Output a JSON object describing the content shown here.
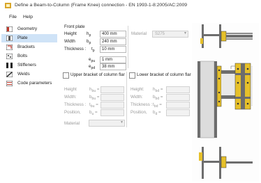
{
  "window": {
    "title": "Define a Beam-to-Column (Frame Knee) connection - EN 1993-1-8:2005/AC:2009"
  },
  "menu": [
    {
      "label": "File"
    },
    {
      "label": "Help"
    }
  ],
  "sidebar": {
    "items": [
      {
        "label": "Geometry",
        "icon": "geometry-icon"
      },
      {
        "label": "Plate",
        "icon": "plate-icon",
        "active": true
      },
      {
        "label": "Brackets",
        "icon": "brackets-icon"
      },
      {
        "label": "Bolts",
        "icon": "bolts-icon"
      },
      {
        "label": "Stiffeners",
        "icon": "stiffeners-icon"
      },
      {
        "label": "Welds",
        "icon": "welds-icon"
      },
      {
        "label": "Code parameters",
        "icon": "code-parameters-icon"
      }
    ]
  },
  "front_plate": {
    "title": "Front plate",
    "height": {
      "label": "Height",
      "symbol": "h",
      "sub": "p",
      "value": "400 mm"
    },
    "width": {
      "label": "Width",
      "symbol": "b",
      "sub": "p",
      "value": "240 mm"
    },
    "thickness": {
      "label": "Thickness :",
      "symbol": "t",
      "sub": "p",
      "value": "10 mm"
    },
    "e_pu": {
      "symbol": "e",
      "sub": "pu",
      "value": "1 mm"
    },
    "e_pd": {
      "symbol": "e",
      "sub": "pd",
      "value": "38 mm"
    },
    "material": {
      "label": "Material",
      "value": "S275"
    }
  },
  "upper_bracket": {
    "checkbox_label": "Upper bracket of column flar",
    "height": {
      "label": "Height",
      "symbol": "h",
      "sub": "bu"
    },
    "width": {
      "label": "Width:",
      "symbol": "b",
      "sub": "bu"
    },
    "thickness": {
      "label": "Thickness :",
      "symbol": "t",
      "sub": "bu"
    },
    "position": {
      "label": "Position,",
      "symbol": "b",
      "sub": "u"
    },
    "material_label": "Material"
  },
  "lower_bracket": {
    "checkbox_label": "Lower bracket of column flar",
    "height": {
      "label": "Height:",
      "symbol": "h",
      "sub": "bd"
    },
    "width": {
      "label": "Width:",
      "symbol": "b",
      "sub": "bd"
    },
    "thickness": {
      "label": "Thickness :",
      "symbol": "t",
      "sub": "bd"
    },
    "position": {
      "label": "Position,",
      "symbol": "b",
      "sub": "d"
    }
  },
  "colors": {
    "steel": "#6d6d6d",
    "plate": "#e6c02a",
    "active": "#cfe3f7"
  }
}
